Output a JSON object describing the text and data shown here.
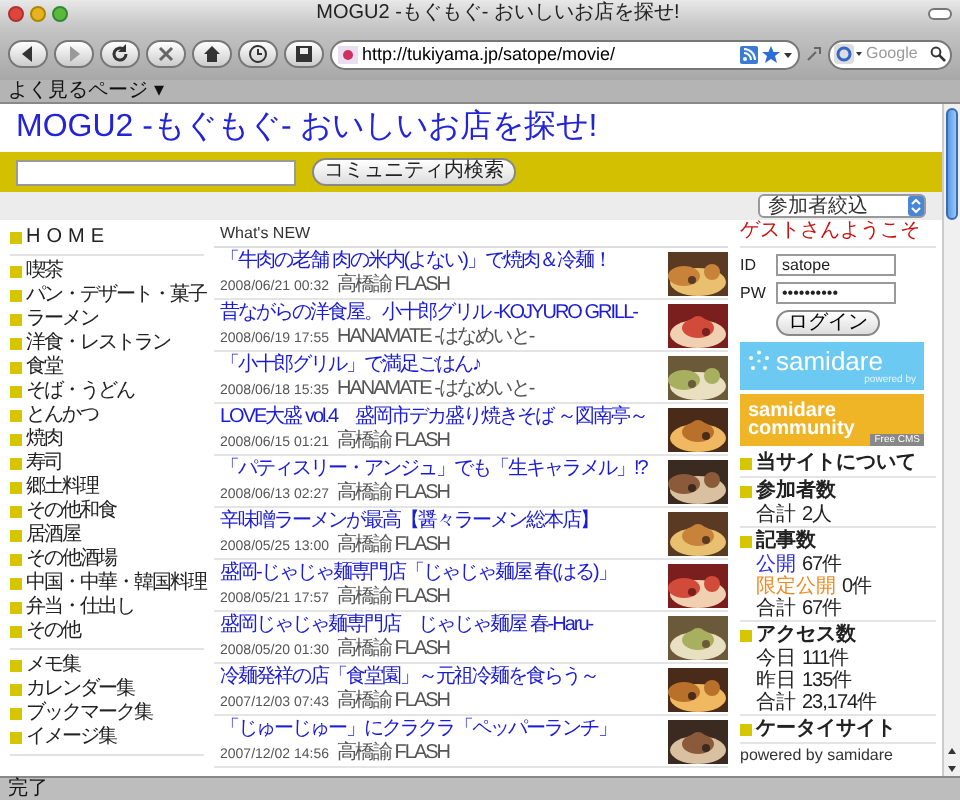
{
  "browser": {
    "title": "MOGU2 -もぐもぐ- おいしいお店を探せ!",
    "url": "http://tukiyama.jp/satope/movie/",
    "search_placeholder": "Google",
    "bookmarks": "よく見るページ ▾",
    "status": "完了"
  },
  "site": {
    "title": "MOGU2 -もぐもぐ- おいしいお店を探せ!",
    "search_button": "コミュニティ内検索",
    "filter": "参加者絞込"
  },
  "sidebar": {
    "groups": [
      [
        "HOME"
      ],
      [
        "喫茶",
        "パン・デザート・菓子",
        "ラーメン",
        "洋食・レストラン",
        "食堂",
        "そば・うどん",
        "とんかつ",
        "焼肉",
        "寿司",
        "郷土料理",
        "その他和食",
        "居酒屋",
        "その他酒場",
        "中国・中華・韓国料理",
        "弁当・仕出し",
        "その他"
      ],
      [
        "メモ集",
        "カレンダー集",
        "ブックマーク集",
        "イメージ集"
      ]
    ]
  },
  "news": {
    "heading": "What's NEW",
    "items": [
      {
        "title": "「牛肉の老舗 肉の米内(よない)」で焼肉＆冷麺！",
        "date": "2008/06/21 00:32",
        "author": "高橋諭 FLASH"
      },
      {
        "title": "昔ながらの洋食屋。小十郎グリル -KOJYURO GRILL-",
        "date": "2008/06/19 17:55",
        "author": "HANAMATE -はなめいと-"
      },
      {
        "title": "「小十郎グリル」で満足ごはん♪",
        "date": "2008/06/18 15:35",
        "author": "HANAMATE -はなめいと-"
      },
      {
        "title": "LOVE大盛 vol.4　盛岡市デカ盛り焼きそば ～図南亭～",
        "date": "2008/06/15 01:21",
        "author": "高橋諭 FLASH"
      },
      {
        "title": "「パティスリー・アンジュ」でも「生キャラメル」!?",
        "date": "2008/06/13 02:27",
        "author": "高橋諭 FLASH"
      },
      {
        "title": "辛味噌ラーメンが最高【醤々ラーメン総本店】",
        "date": "2008/05/25 13:00",
        "author": "高橋諭 FLASH"
      },
      {
        "title": "盛岡-じゃじゃ麺専門店「じゃじゃ麺屋 春(はる)」",
        "date": "2008/05/21 17:57",
        "author": "高橋諭 FLASH"
      },
      {
        "title": "盛岡じゃじゃ麺専門店　じゃじゃ麺屋 春-Haru-",
        "date": "2008/05/20 01:30",
        "author": "高橋諭 FLASH"
      },
      {
        "title": "冷麺発祥の店「食堂園」～元祖冷麺を食らう～",
        "date": "2007/12/03 07:43",
        "author": "高橋諭 FLASH"
      },
      {
        "title": "「じゅーじゅー」にクラクラ「ペッパーランチ」",
        "date": "2007/12/02 14:56",
        "author": "高橋諭 FLASH"
      }
    ]
  },
  "login": {
    "welcome": "ゲストさんようこそ",
    "id_label": "ID",
    "id_value": "satope",
    "pw_label": "PW",
    "pw_value": "••••••••••",
    "button": "ログイン"
  },
  "banners": [
    {
      "kind": "samidare",
      "lines": [
        "samidare"
      ],
      "caption": "powered by"
    },
    {
      "kind": "community",
      "lines": [
        "samidare",
        "community"
      ],
      "caption": "Free CMS"
    }
  ],
  "stats": [
    {
      "heading": "当サイトについて"
    },
    {
      "heading": "参加者数",
      "lines": [
        {
          "kind": "plain",
          "label": "合計",
          "value": "2人"
        }
      ]
    },
    {
      "heading": "記事数",
      "lines": [
        {
          "kind": "public",
          "label": "公開",
          "value": "67件"
        },
        {
          "kind": "limited",
          "label": "限定公開",
          "value": "0件"
        },
        {
          "kind": "plain",
          "label": "合計",
          "value": "67件"
        }
      ]
    },
    {
      "heading": "アクセス数",
      "lines": [
        {
          "kind": "plain",
          "label": "今日",
          "value": "111件"
        },
        {
          "kind": "plain",
          "label": "昨日",
          "value": "135件"
        },
        {
          "kind": "plain",
          "label": "合計",
          "value": "23,174件"
        }
      ]
    },
    {
      "heading": "ケータイサイト"
    }
  ],
  "footer": "powered by samidare"
}
